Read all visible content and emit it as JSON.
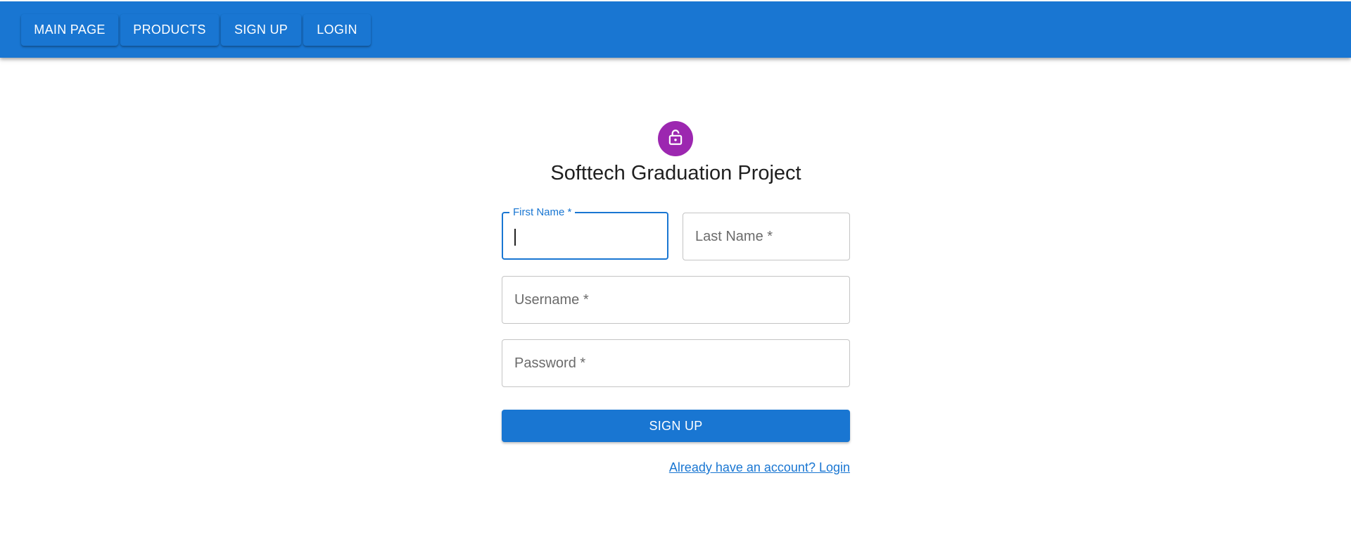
{
  "nav": {
    "items": [
      {
        "label": "MAIN PAGE"
      },
      {
        "label": "PRODUCTS"
      },
      {
        "label": "SIGN UP"
      },
      {
        "label": "LOGIN"
      }
    ]
  },
  "form": {
    "icon": "lock-open-icon",
    "title": "Softtech Graduation Project",
    "first_name_label": "First Name *",
    "first_name_value": "",
    "last_name_label": "Last Name *",
    "username_label": "Username *",
    "password_label": "Password *",
    "submit_label": "SIGN UP",
    "login_link": "Already have an account? Login"
  },
  "colors": {
    "primary": "#1976d2",
    "avatar": "#9c27b0"
  }
}
